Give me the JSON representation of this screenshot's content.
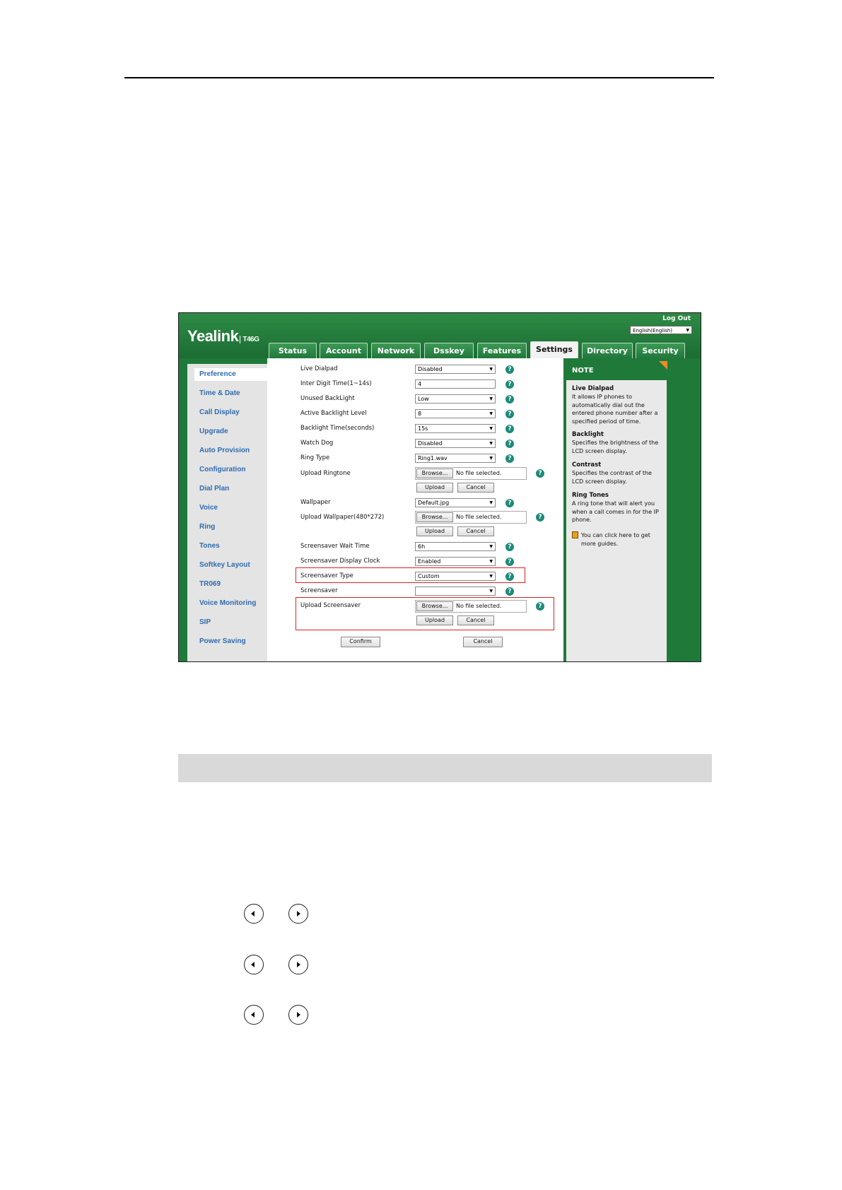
{
  "header": {
    "brand": "Yealink",
    "model": "T46G",
    "logout": "Log Out",
    "language": "English(English)"
  },
  "tabs": [
    {
      "label": "Status"
    },
    {
      "label": "Account"
    },
    {
      "label": "Network"
    },
    {
      "label": "Dsskey"
    },
    {
      "label": "Features"
    },
    {
      "label": "Settings"
    },
    {
      "label": "Directory"
    },
    {
      "label": "Security"
    }
  ],
  "sidebar": {
    "items": [
      {
        "label": "Preference"
      },
      {
        "label": "Time & Date"
      },
      {
        "label": "Call Display"
      },
      {
        "label": "Upgrade"
      },
      {
        "label": "Auto Provision"
      },
      {
        "label": "Configuration"
      },
      {
        "label": "Dial Plan"
      },
      {
        "label": "Voice"
      },
      {
        "label": "Ring"
      },
      {
        "label": "Tones"
      },
      {
        "label": "Softkey Layout"
      },
      {
        "label": "TR069"
      },
      {
        "label": "Voice Monitoring"
      },
      {
        "label": "SIP"
      },
      {
        "label": "Power Saving"
      }
    ]
  },
  "form": {
    "live_dialpad": {
      "label": "Live Dialpad",
      "value": "Disabled"
    },
    "inter_digit": {
      "label": "Inter Digit Time(1~14s)",
      "value": "4"
    },
    "unused_backlight": {
      "label": "Unused BackLight",
      "value": "Low"
    },
    "active_backlight": {
      "label": "Active Backlight Level",
      "value": "8"
    },
    "backlight_time": {
      "label": "Backlight Time(seconds)",
      "value": "15s"
    },
    "watch_dog": {
      "label": "Watch Dog",
      "value": "Disabled"
    },
    "ring_type": {
      "label": "Ring Type",
      "value": "Ring1.wav"
    },
    "upload_ringtone": {
      "label": "Upload Ringtone"
    },
    "wallpaper": {
      "label": "Wallpaper",
      "value": "Default.jpg"
    },
    "upload_wallpaper": {
      "label": "Upload Wallpaper(480*272)"
    },
    "screensaver_wait": {
      "label": "Screensaver Wait Time",
      "value": "6h"
    },
    "screensaver_clock": {
      "label": "Screensaver Display Clock",
      "value": "Enabled"
    },
    "screensaver_type": {
      "label": "Screensaver Type",
      "value": "Custom"
    },
    "screensaver": {
      "label": "Screensaver",
      "value": ""
    },
    "upload_screensaver": {
      "label": "Upload Screensaver"
    },
    "browse_label": "Browse...",
    "no_file": "No file selected.",
    "upload_label": "Upload",
    "cancel_label": "Cancel",
    "confirm_label": "Confirm",
    "help_glyph": "?"
  },
  "note": {
    "title": "NOTE",
    "items": [
      {
        "title": "Live Dialpad",
        "text": "It allows IP phones to automatically dial out the entered phone number after a specified period of time."
      },
      {
        "title": "Backlight",
        "text": "Specifies the brightness of the LCD screen display."
      },
      {
        "title": "Contrast",
        "text": "Specifies the contrast of the LCD screen display."
      },
      {
        "title": "Ring Tones",
        "text": "A ring tone that will alert you when a call comes in for the IP phone."
      }
    ],
    "guide": "You can click here to get more guides."
  },
  "colors": {
    "brand_green": "#1f7a3a",
    "highlight_red": "#e02020",
    "note_corner": "#f08a24",
    "link_blue": "#2e6bb0"
  }
}
